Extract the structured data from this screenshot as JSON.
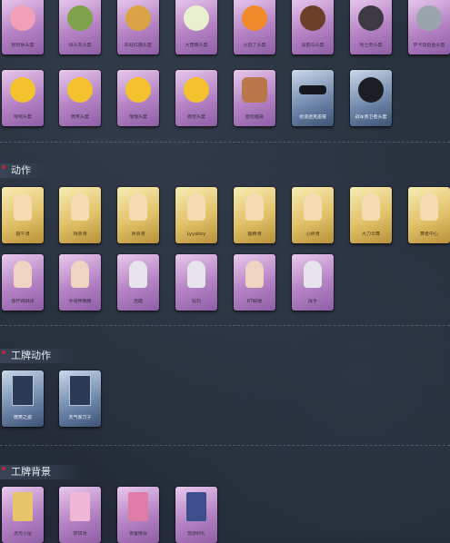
{
  "sections": {
    "masks": {
      "row1": [
        "粉粉豚头套",
        "绿头发头套",
        "彩贴红鹿头套",
        "大葱精头套",
        "火焰了头套",
        "黑鹤马头套",
        "哈士奇头套",
        "萨卡斑斑鱼头套"
      ],
      "row2": [
        "嘻嘻头套",
        "微笑头套",
        "懵懵头套",
        "痛苦头套",
        "面包脑袋",
        "张漫迷克墨镜",
        "战军亲卫者头套"
      ]
    },
    "actions": {
      "title": "动作",
      "row1": [
        "翻午骑",
        "相亲骑",
        "娇贤骑",
        "Lyyaboy",
        "翻腾骑",
        "心醉骑",
        "大力伞舞",
        "舞者中心"
      ],
      "row2": [
        "摇杆跳跳球",
        "手语伸懒腰",
        "连踏",
        "钻石",
        "KT联播",
        "挥手"
      ]
    },
    "card_actions": {
      "title": "工牌动作",
      "items": [
        "微笑之姿",
        "天气家刀子"
      ]
    },
    "card_backgrounds": {
      "title": "工牌背景",
      "items": [
        "流光小屋",
        "梦境场",
        "夜萤晚会",
        "悠游照礼"
      ]
    }
  },
  "colors": {
    "background": "#262d3a",
    "purple_tile": "#b482c4",
    "gold_tile": "#e2c26a",
    "blue_tile": "#6c84a8",
    "accent_bullet": "#c0283a"
  }
}
